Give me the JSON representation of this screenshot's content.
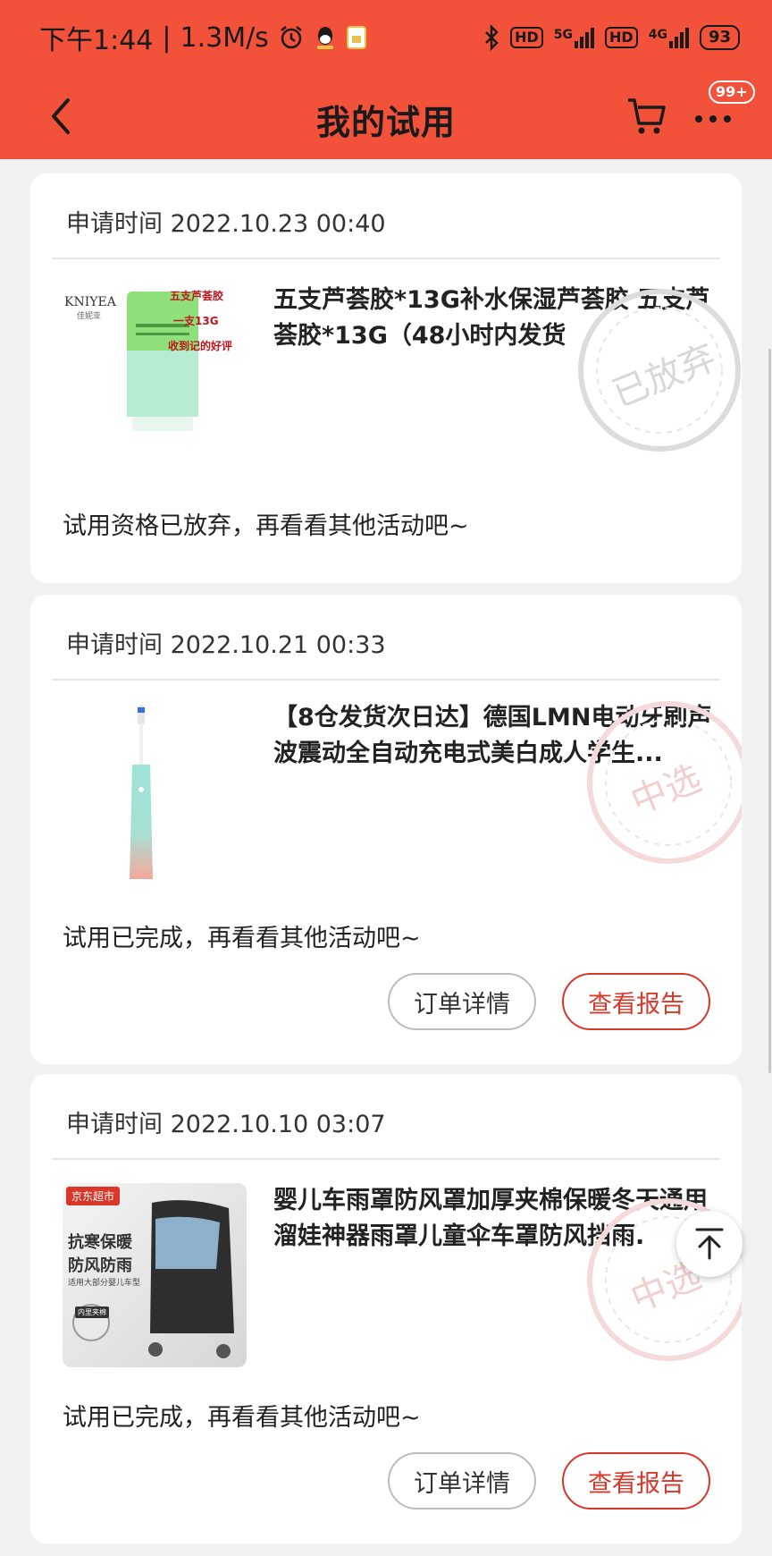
{
  "status_bar": {
    "time": "下午1:44",
    "speed": "1.3M/s",
    "hd1": "HD",
    "net1": "5G",
    "hd2": "HD",
    "net2": "4G",
    "battery": "93"
  },
  "header": {
    "title": "我的试用",
    "badge": "99+"
  },
  "cards": [
    {
      "apply_time": "申请时间  2022.10.23  00:40",
      "product_name": "五支芦荟胶*13G补水保湿芦荟胶 五支芦荟胶*13G（48小时内发货",
      "status_text": "试用资格已放弃，再看看其他活动吧~",
      "stamp_text": "已放弃",
      "thumb": {
        "brand": "KNIYEA",
        "brand_sub": "佳妮亚",
        "promo_line1": "五支芦荟胶",
        "promo_line2": "一支13G",
        "promo_line3": "收到记的好评"
      }
    },
    {
      "apply_time": "申请时间  2022.10.21  00:33",
      "product_name": "【8仓发货次日达】德国LMN电动牙刷声波震动全自动充电式美白成人学生...",
      "status_text": "试用已完成，再看看其他活动吧~",
      "stamp_text": "中选",
      "btn_detail": "订单详情",
      "btn_report": "查看报告"
    },
    {
      "apply_time": "申请时间  2022.10.10  03:07",
      "product_name": "婴儿车雨罩防风罩加厚夹棉保暖冬天通用溜娃神器雨罩儿童伞车罩防风挡雨.",
      "status_text": "试用已完成，再看看其他活动吧~",
      "stamp_text": "中选",
      "btn_detail": "订单详情",
      "btn_report": "查看报告",
      "thumb": {
        "shop_tag": "京东超市",
        "line1": "抗寒保暖",
        "line2": "防风防雨",
        "line3": "适用大部分婴儿车型",
        "tag2": "内里夹棉"
      }
    }
  ],
  "colors": {
    "header_bg": "#f2523a",
    "accent_red": "#d9372a"
  }
}
